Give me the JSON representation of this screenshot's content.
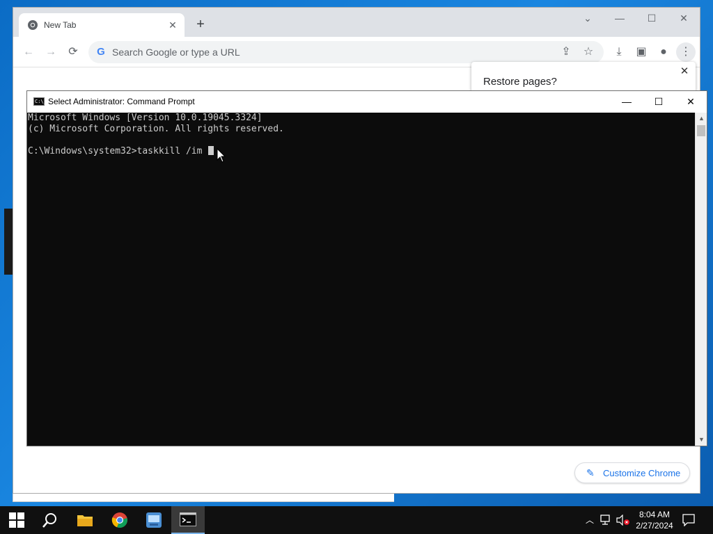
{
  "chrome": {
    "tab_title": "New Tab",
    "tab_close": "✕",
    "new_tab": "+",
    "omnibox_placeholder": "Search Google or type a URL",
    "restore_title": "Restore pages?",
    "restore_close": "✕",
    "customize_label": "Customize Chrome",
    "win_controls": {
      "tab_search": "⌄",
      "minimize": "—",
      "maximize": "☐",
      "close": "✕"
    }
  },
  "cmd": {
    "title": "Select Administrator: Command Prompt",
    "icon_text": "C:\\_",
    "lines": [
      "Microsoft Windows [Version 10.0.19045.3324]",
      "(c) Microsoft Corporation. All rights reserved.",
      "",
      "C:\\Windows\\system32>taskkill /im "
    ],
    "controls": {
      "minimize": "—",
      "maximize": "☐",
      "close": "✕"
    }
  },
  "taskbar": {
    "time": "8:04 AM",
    "date": "2/27/2024"
  },
  "colors": {
    "desktop": "#0b6cc5",
    "cmd_bg": "#0c0c0c",
    "cmd_text": "#cccccc",
    "accent": "#1a73e8"
  }
}
